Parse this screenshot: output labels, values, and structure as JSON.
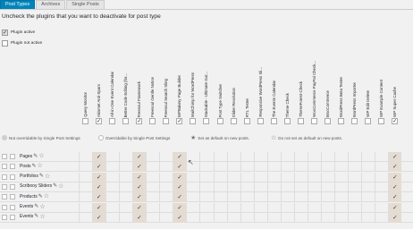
{
  "tabs": [
    {
      "label": "Post Types",
      "active": true
    },
    {
      "label": "Archives",
      "active": false
    },
    {
      "label": "Single Posts",
      "active": false
    }
  ],
  "heading": "Uncheck the plugins that you want to deactivate for post type",
  "legend": {
    "active_label": "Plugin active",
    "inactive_label": "Plugin not active"
  },
  "plugins": [
    {
      "name": "Query Monitor",
      "col": 0
    },
    {
      "name": "Akismet Anti-Spam",
      "col": 1
    },
    {
      "name": "All-in-One Event Calendar",
      "col": 2
    },
    {
      "name": "Better Code Editing (for...",
      "col": 3
    },
    {
      "name": "Freesoul Framework",
      "col": 4
    },
    {
      "name": "Freesoul Gentle Notice",
      "col": 5
    },
    {
      "name": "Freesoul Search Sling",
      "col": 6
    },
    {
      "name": "WPBakery Page Builder",
      "col": 7
    },
    {
      "name": "MailChimp for WordPress",
      "col": 8
    },
    {
      "name": "Stackable - Ultimate Gut...",
      "col": 9
    },
    {
      "name": "Post Type Switcher",
      "col": 10
    },
    {
      "name": "Slider Revolution",
      "col": 11
    },
    {
      "name": "RTL Tester",
      "col": 12
    },
    {
      "name": "Responsive WordPress Sli...",
      "col": 13
    },
    {
      "name": "The Events Calendar",
      "col": 14
    },
    {
      "name": "Theme Check",
      "col": 15
    },
    {
      "name": "ThemeForest-Check",
      "col": 16
    },
    {
      "name": "WooCommerce PayPal Check...",
      "col": 17
    },
    {
      "name": "WooCommerce",
      "col": 18
    },
    {
      "name": "WordPress Beta Tester",
      "col": 19
    },
    {
      "name": "WordPress Importer",
      "col": 20
    },
    {
      "name": "WP Edit Delete",
      "col": 21
    },
    {
      "name": "WP Example Content",
      "col": 22
    },
    {
      "name": "WP Super Cache",
      "col": 23
    }
  ],
  "active_columns": [
    1,
    4,
    7,
    23
  ],
  "bottom_legend": {
    "not_overridable": "Not overridable by Single Post Settings",
    "overridable": "Overridable by Single Post Settings",
    "default_on": "Set as default on new posts.",
    "default_off": "Do not set as default on new posts."
  },
  "rows": [
    {
      "label": "Pages"
    },
    {
      "label": "Posts"
    },
    {
      "label": "Portfolios"
    },
    {
      "label": "Scribooy Sliders"
    },
    {
      "label": "Products"
    },
    {
      "label": "Events"
    },
    {
      "label": "Events"
    }
  ],
  "icons": {
    "check": "✓",
    "edit": "✎",
    "star": "☆",
    "star_filled": "★",
    "cursor": "↖"
  }
}
